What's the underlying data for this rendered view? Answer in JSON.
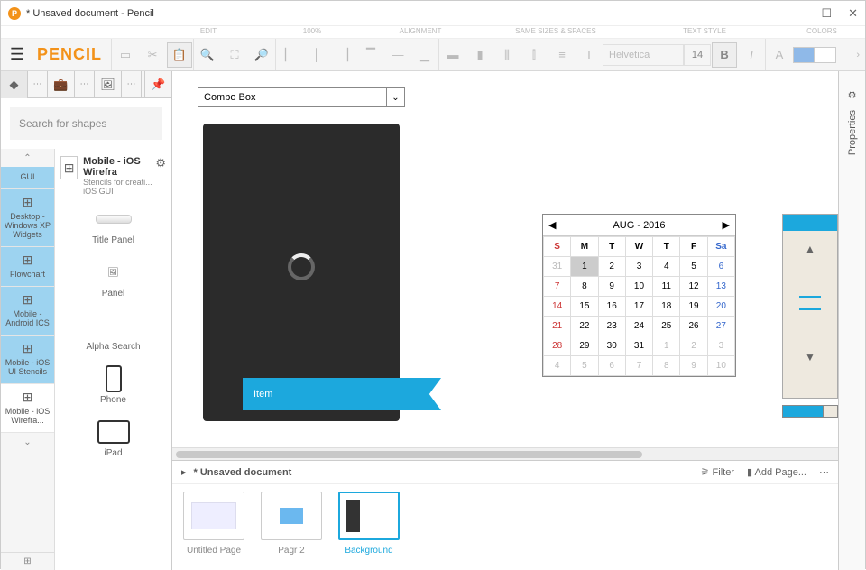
{
  "window": {
    "title": "* Unsaved document - Pencil"
  },
  "brand": "PENCIL",
  "tool_headers": {
    "edit": "EDIT",
    "zoom": "100%",
    "align": "ALIGNMENT",
    "same": "SAME SIZES & SPACES",
    "text": "TEXT STYLE",
    "colors": "COLORS"
  },
  "font": {
    "name": "Helvetica",
    "size": "14"
  },
  "sidebar": {
    "search_placeholder": "Search for shapes",
    "categories": [
      {
        "label": "GUI"
      },
      {
        "label": "Desktop - Windows XP Widgets"
      },
      {
        "label": "Flowchart"
      },
      {
        "label": "Mobile - Android ICS"
      },
      {
        "label": "Mobile - iOS UI Stencils"
      },
      {
        "label": "Mobile - iOS Wirefra..."
      }
    ],
    "collection": {
      "title": "Mobile - iOS Wirefra",
      "desc": "Stencils for creati... iOS GUI"
    },
    "shapes": [
      {
        "label": "Title Panel"
      },
      {
        "label": "Panel"
      },
      {
        "label": "Alpha Search"
      },
      {
        "label": "Phone"
      },
      {
        "label": "iPad"
      }
    ]
  },
  "canvas": {
    "combo_label": "Combo Box",
    "ribbon_label": "Item"
  },
  "calendar": {
    "title": "AUG - 2016",
    "days": [
      "S",
      "M",
      "T",
      "W",
      "T",
      "F",
      "Sa"
    ],
    "rows": [
      [
        "31",
        "1",
        "2",
        "3",
        "4",
        "5",
        "6"
      ],
      [
        "7",
        "8",
        "9",
        "10",
        "11",
        "12",
        "13"
      ],
      [
        "14",
        "15",
        "16",
        "17",
        "18",
        "19",
        "20"
      ],
      [
        "21",
        "22",
        "23",
        "24",
        "25",
        "26",
        "27"
      ],
      [
        "28",
        "29",
        "30",
        "31",
        "1",
        "2",
        "3"
      ],
      [
        "4",
        "5",
        "6",
        "7",
        "8",
        "9",
        "10"
      ]
    ]
  },
  "pages": {
    "doc_title": "* Unsaved document",
    "filter": "Filter",
    "add": "Add Page...",
    "thumbs": [
      {
        "label": "Untitled Page"
      },
      {
        "label": "Pagr 2"
      },
      {
        "label": "Background"
      }
    ]
  },
  "right_panel": {
    "label": "Properties"
  }
}
